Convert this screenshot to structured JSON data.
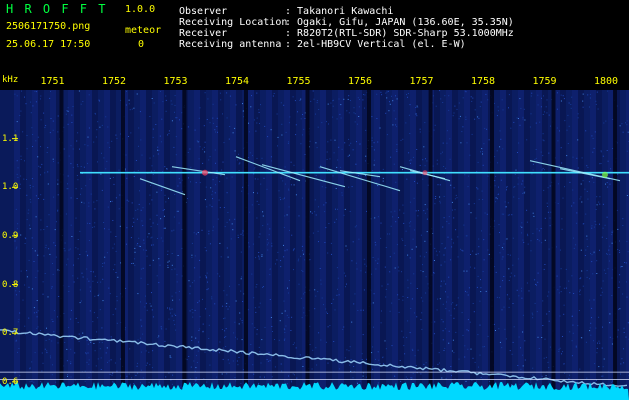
{
  "app": {
    "title": "H R O F F T",
    "version": "1.0.0",
    "filename": "2506171750.png",
    "timestamp": "25.06.17 17:50",
    "meteor_label": "meteor",
    "meteor_count": "0"
  },
  "info": {
    "rows": [
      {
        "label": "Observer",
        "value": ": Takanori Kawachi"
      },
      {
        "label": "Receiving Location",
        "value": ": Ogaki, Gifu, JAPAN (136.60E, 35.35N)"
      },
      {
        "label": "Receiver",
        "value": ": R820T2(RTL-SDR) SDR-Sharp 53.1000MHz"
      },
      {
        "label": "Receiving antenna",
        "value": ": 2el-HB9CV Vertical (el. E-W)"
      }
    ]
  },
  "spectrogram": {
    "y_unit": "kHz",
    "y_ticks": [
      "1.1",
      "1.0",
      "0.9",
      "0.8",
      "0.7",
      "0.6"
    ],
    "y_tick_values": [
      1.1,
      1.0,
      0.9,
      0.8,
      0.7,
      0.6
    ],
    "x_ticks": [
      "1751",
      "1752",
      "1753",
      "1754",
      "1755",
      "1756",
      "1757",
      "1758",
      "1759",
      "1800"
    ],
    "y_range": [
      0.575,
      1.2
    ],
    "carrier_freq": 1.03,
    "lower_band_start": 0.705,
    "lower_band_end": 0.59,
    "colors": {
      "background": "#0a1a5a",
      "axis_text": "#ffff00",
      "carrier": "#40e0ff",
      "band": "#a0d8ff",
      "baseline": "#00d8ff"
    }
  }
}
